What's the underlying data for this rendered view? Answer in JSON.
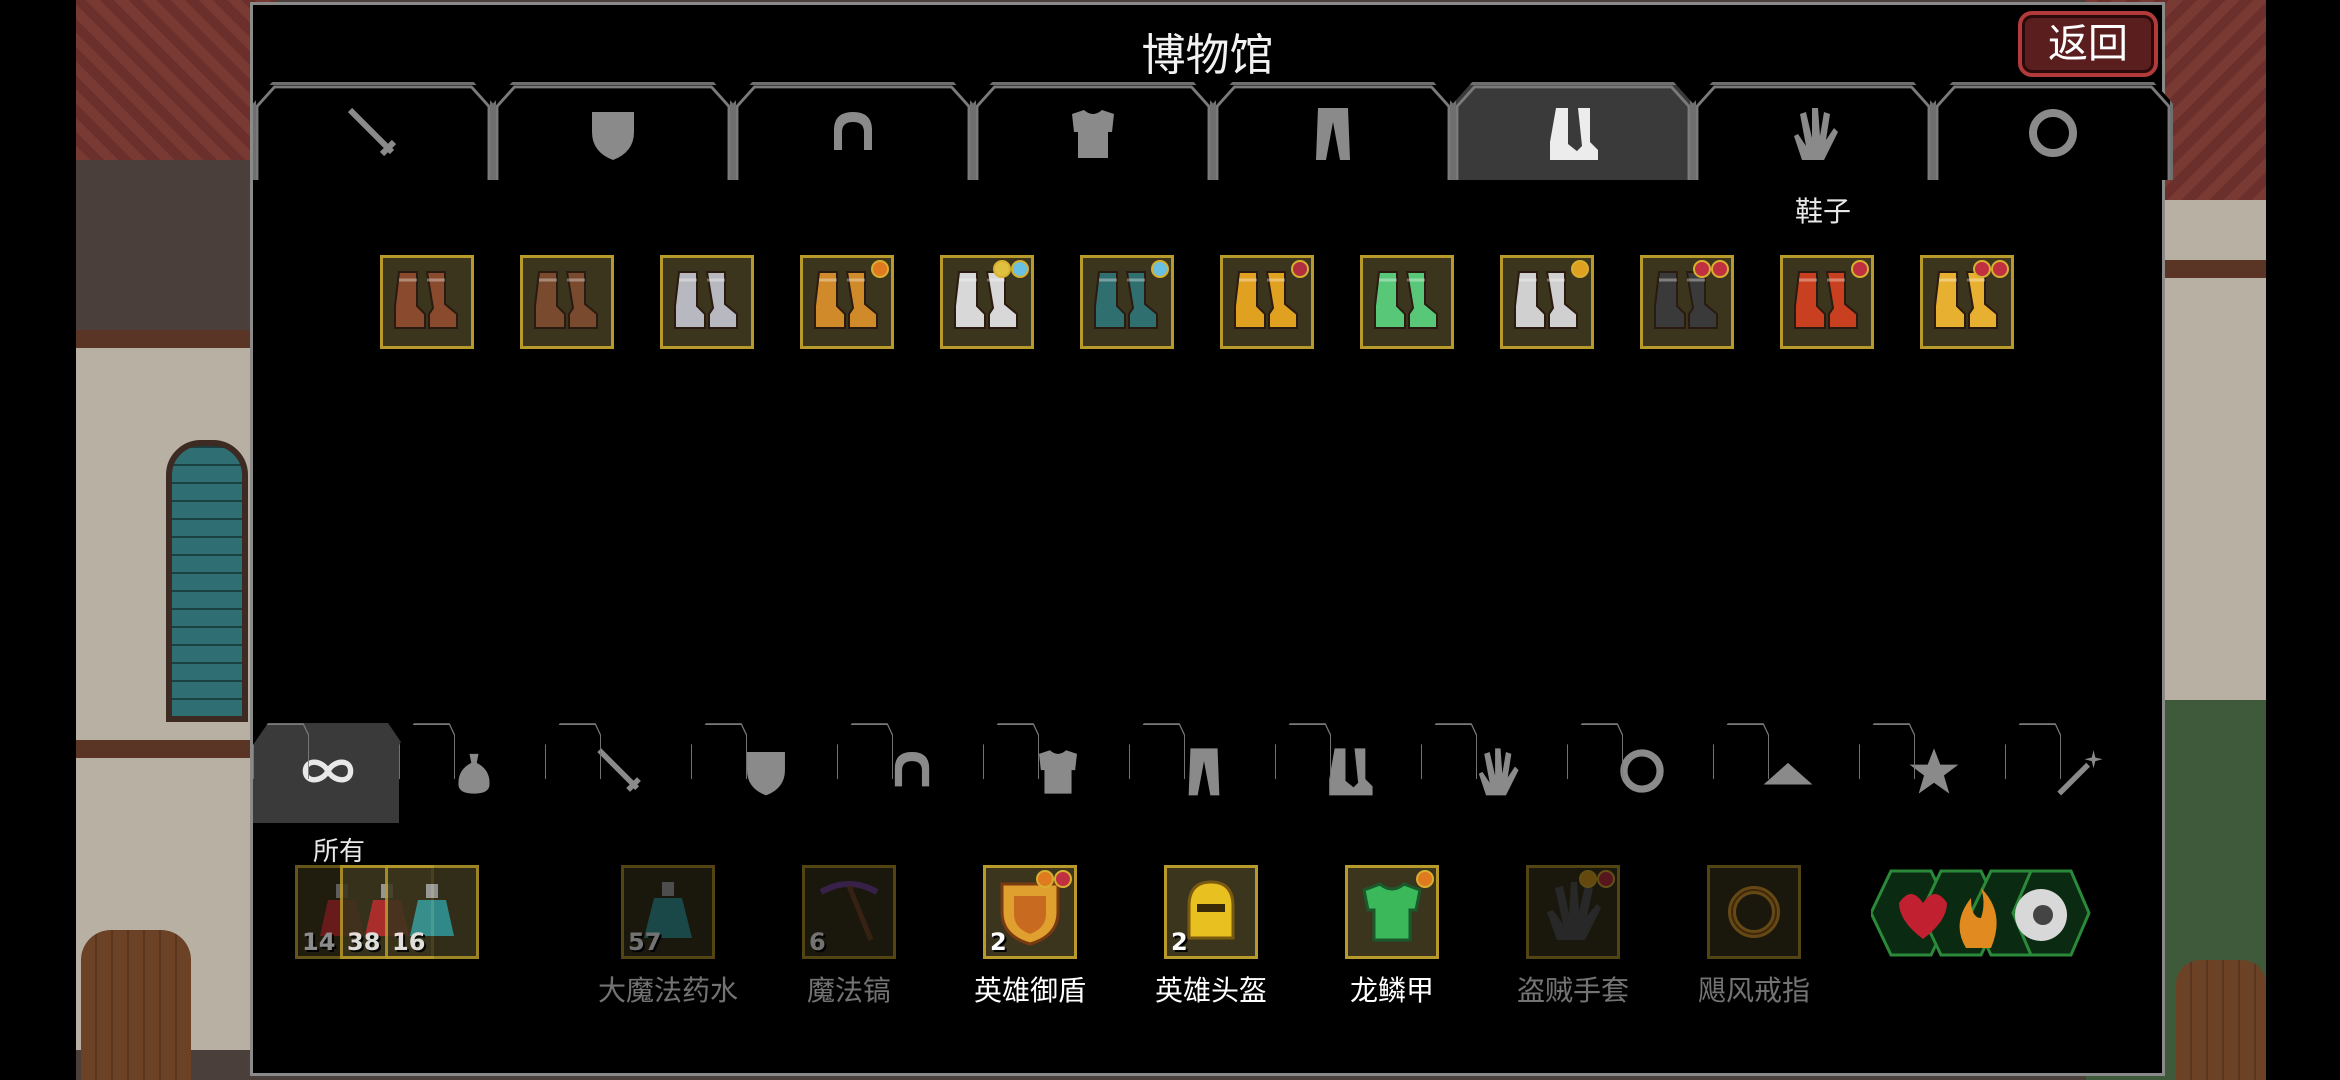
{
  "title": "博物馆",
  "back_label": "返回",
  "top_tabs": [
    {
      "icon": "sword-icon",
      "active": false
    },
    {
      "icon": "shield-icon",
      "active": false
    },
    {
      "icon": "helmet-icon",
      "active": false
    },
    {
      "icon": "armor-icon",
      "active": false
    },
    {
      "icon": "pants-icon",
      "active": false
    },
    {
      "icon": "boots-icon",
      "active": true
    },
    {
      "icon": "glove-icon",
      "active": false
    },
    {
      "icon": "ring-icon",
      "active": false
    }
  ],
  "active_top_tab_label": "鞋子",
  "boots": [
    {
      "color": "#8a4a2e",
      "gems": []
    },
    {
      "color": "#7a4a2e",
      "gems": []
    },
    {
      "color": "#b8b8c0",
      "gems": []
    },
    {
      "color": "#d08a2a",
      "gems": [
        "#e07a20"
      ]
    },
    {
      "color": "#d8d8d8",
      "gems": [
        "#6ac0e0",
        "#e0c040"
      ]
    },
    {
      "color": "#2f6f6f",
      "gems": [
        "#6ac0e0"
      ]
    },
    {
      "color": "#e0a020",
      "gems": [
        "#b03040"
      ]
    },
    {
      "color": "#58c878",
      "gems": []
    },
    {
      "color": "#d0d0d0",
      "gems": [
        "#e0a020"
      ]
    },
    {
      "color": "#3a3a3a",
      "gems": [
        "#c03040",
        "#c03040"
      ]
    },
    {
      "color": "#c84020",
      "gems": [
        "#c03040"
      ]
    },
    {
      "color": "#e8b030",
      "gems": [
        "#c03040",
        "#c03040"
      ]
    }
  ],
  "bottom_tabs": [
    {
      "icon": "infinity-icon",
      "active": true
    },
    {
      "icon": "bag-icon",
      "active": false
    },
    {
      "icon": "sword-icon",
      "active": false
    },
    {
      "icon": "shield-icon",
      "active": false
    },
    {
      "icon": "helmet-icon",
      "active": false
    },
    {
      "icon": "armor-icon",
      "active": false
    },
    {
      "icon": "pants-icon",
      "active": false
    },
    {
      "icon": "boots-icon",
      "active": false
    },
    {
      "icon": "glove-icon",
      "active": false
    },
    {
      "icon": "ring-icon",
      "active": false
    },
    {
      "icon": "hat-icon",
      "active": false
    },
    {
      "icon": "star-icon",
      "active": false
    },
    {
      "icon": "wand-icon",
      "active": false
    }
  ],
  "active_bottom_tab_label": "所有",
  "potion_group": {
    "counts": [
      "14",
      "38",
      "16"
    ]
  },
  "bottom_items": [
    {
      "label": "大魔法药水",
      "count": "57",
      "dim": true,
      "icon": "potion-icon"
    },
    {
      "label": "魔法镐",
      "count": "6",
      "dim": true,
      "icon": "pickaxe-icon"
    },
    {
      "label": "英雄御盾",
      "count": "2",
      "dim": false,
      "icon": "hero-shield-icon"
    },
    {
      "label": "英雄头盔",
      "count": "2",
      "dim": false,
      "icon": "hero-helmet-icon"
    },
    {
      "label": "龙鳞甲",
      "count": "",
      "dim": false,
      "icon": "dragon-armor-icon"
    },
    {
      "label": "盗贼手套",
      "count": "",
      "dim": true,
      "icon": "thief-glove-icon"
    },
    {
      "label": "飓风戒指",
      "count": "",
      "dim": true,
      "icon": "hurricane-ring-icon"
    }
  ],
  "colors": {
    "accent_gold": "#b89a2a",
    "back_red": "#b23a3a",
    "tab_active": "#3a3a3a"
  }
}
